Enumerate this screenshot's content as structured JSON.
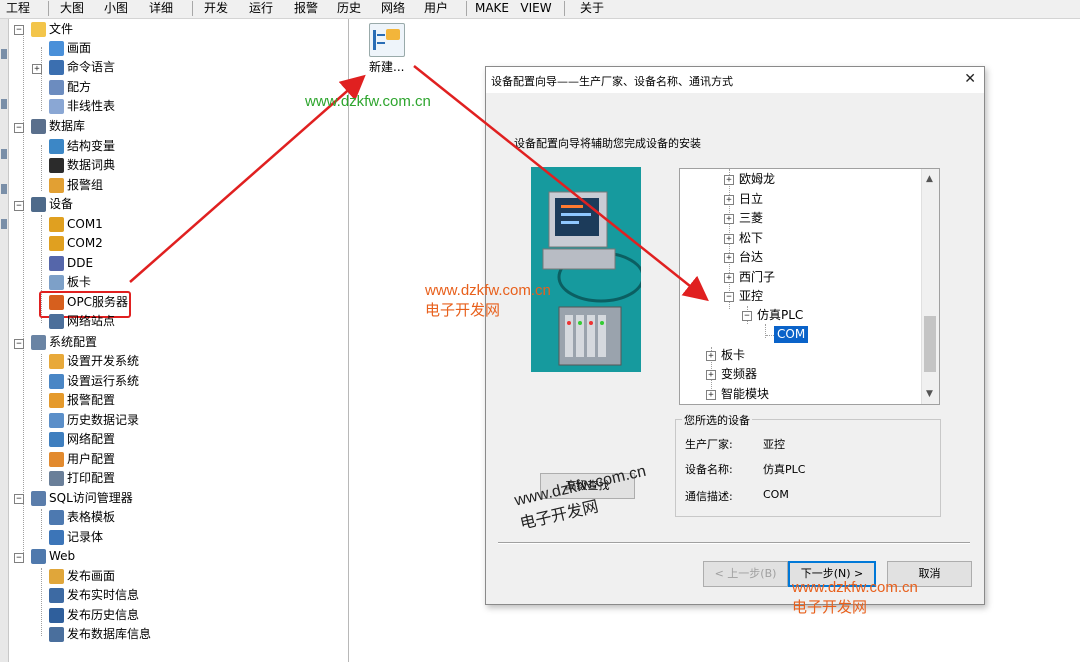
{
  "menubar": {
    "items": [
      "工程",
      "大图",
      "小图",
      "详细",
      "开发",
      "运行",
      "报警",
      "历史",
      "网络",
      "用户",
      "MAKE",
      "VIEW",
      "关于"
    ]
  },
  "tree": {
    "file": {
      "label": "文件",
      "children": [
        {
          "label": "画面",
          "icon": "screen-icon"
        },
        {
          "label": "命令语言",
          "icon": "command-icon"
        },
        {
          "label": "配方",
          "icon": "recipe-icon"
        },
        {
          "label": "非线性表",
          "icon": "nonlinear-table-icon"
        }
      ]
    },
    "database": {
      "label": "数据库",
      "children": [
        {
          "label": "结构变量",
          "icon": "struct-variable-icon"
        },
        {
          "label": "数据词典",
          "icon": "data-dictionary-icon"
        },
        {
          "label": "报警组",
          "icon": "alarm-group-icon"
        }
      ]
    },
    "device": {
      "label": "设备",
      "children": [
        {
          "label": "COM1",
          "icon": "com-port-icon"
        },
        {
          "label": "COM2",
          "icon": "com-port-icon"
        },
        {
          "label": "DDE",
          "icon": "dde-icon"
        },
        {
          "label": "板卡",
          "icon": "board-card-icon"
        },
        {
          "label": "OPC服务器",
          "icon": "opc-server-icon"
        },
        {
          "label": "网络站点",
          "icon": "network-site-icon"
        }
      ]
    },
    "sysconfig": {
      "label": "系统配置",
      "children": [
        {
          "label": "设置开发系统",
          "icon": "dev-system-icon"
        },
        {
          "label": "设置运行系统",
          "icon": "run-system-icon"
        },
        {
          "label": "报警配置",
          "icon": "alarm-config-icon"
        },
        {
          "label": "历史数据记录",
          "icon": "history-record-icon"
        },
        {
          "label": "网络配置",
          "icon": "network-config-icon"
        },
        {
          "label": "用户配置",
          "icon": "user-config-icon"
        },
        {
          "label": "打印配置",
          "icon": "print-config-icon"
        }
      ]
    },
    "sql": {
      "label": "SQL访问管理器",
      "children": [
        {
          "label": "表格模板",
          "icon": "table-template-icon"
        },
        {
          "label": "记录体",
          "icon": "record-body-icon"
        }
      ]
    },
    "web": {
      "label": "Web",
      "children": [
        {
          "label": "发布画面",
          "icon": "publish-screen-icon"
        },
        {
          "label": "发布实时信息",
          "icon": "publish-realtime-icon"
        },
        {
          "label": "发布历史信息",
          "icon": "publish-history-icon"
        },
        {
          "label": "发布数据库信息",
          "icon": "publish-database-icon"
        }
      ]
    }
  },
  "workspace": {
    "new_label": "新建..."
  },
  "dialog": {
    "title": "设备配置向导——生产厂家、设备名称、通讯方式",
    "intro": "设备配置向导将辅助您完成设备的安装",
    "list_items": [
      "欧姆龙",
      "日立",
      "三菱",
      "松下",
      "台达",
      "西门子",
      "亚控"
    ],
    "sub_item": "仿真PLC",
    "selected_item": "COM",
    "bottom_items": [
      "板卡",
      "变频器",
      "智能模块"
    ],
    "group_title": "您所选的设备",
    "manufacturer_label": "生产厂家:",
    "manufacturer_value": "亚控",
    "device_name_label": "设备名称:",
    "device_name_value": "仿真PLC",
    "comm_label": "通信描述:",
    "comm_value": "COM",
    "advanced_button": "高级查找",
    "prev_button": "< 上一步(B)",
    "next_button": "下一步(N) >",
    "cancel_button": "取消"
  },
  "watermarks": {
    "url": "www.dzkfw.com.cn",
    "site_name": "电子开发网"
  },
  "colors": {
    "highlight_red": "#e02020",
    "selection_blue": "#0a63c9",
    "watermark_green": "#2ea52e",
    "watermark_orange": "#e8601c"
  }
}
